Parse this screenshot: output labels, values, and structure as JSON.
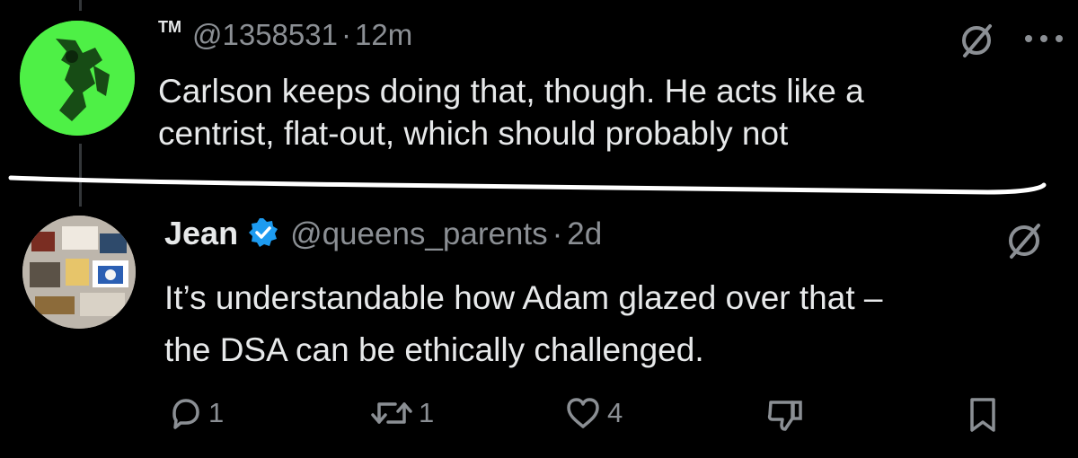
{
  "tweet1": {
    "display_name": "TM",
    "handle": "@1358531",
    "separator": "·",
    "time": "12m",
    "text_line1": "Carlson keeps doing that, though. He acts like a",
    "text_line2": "centrist, flat-out, which should probably not",
    "avatar_icon": "green-figure-avatar",
    "action_icons": [
      "grok-icon",
      "more-icon"
    ]
  },
  "tweet2": {
    "display_name": "Jean",
    "verified_icon": "verified-badge-icon",
    "handle": "@queens_parents",
    "separator": "·",
    "time": "2d",
    "text_line1": "It’s understandable how Adam glazed over that –",
    "text_line2": "the DSA can be ethically challenged.",
    "avatar_icon": "photo-avatar",
    "grok_icon": "grok-icon",
    "actions": {
      "reply_count": "1",
      "retweet_count": "1",
      "like_count": "4"
    },
    "action_icons": [
      "reply-icon",
      "retweet-icon",
      "like-icon",
      "dislike-icon",
      "bookmark-icon"
    ]
  },
  "colors": {
    "background": "#000000",
    "text": "#e7e9ea",
    "secondary": "#8b8f94",
    "verified": "#1d9bf0",
    "avatar_green": "#4ef046",
    "divider": "#ffffff"
  }
}
